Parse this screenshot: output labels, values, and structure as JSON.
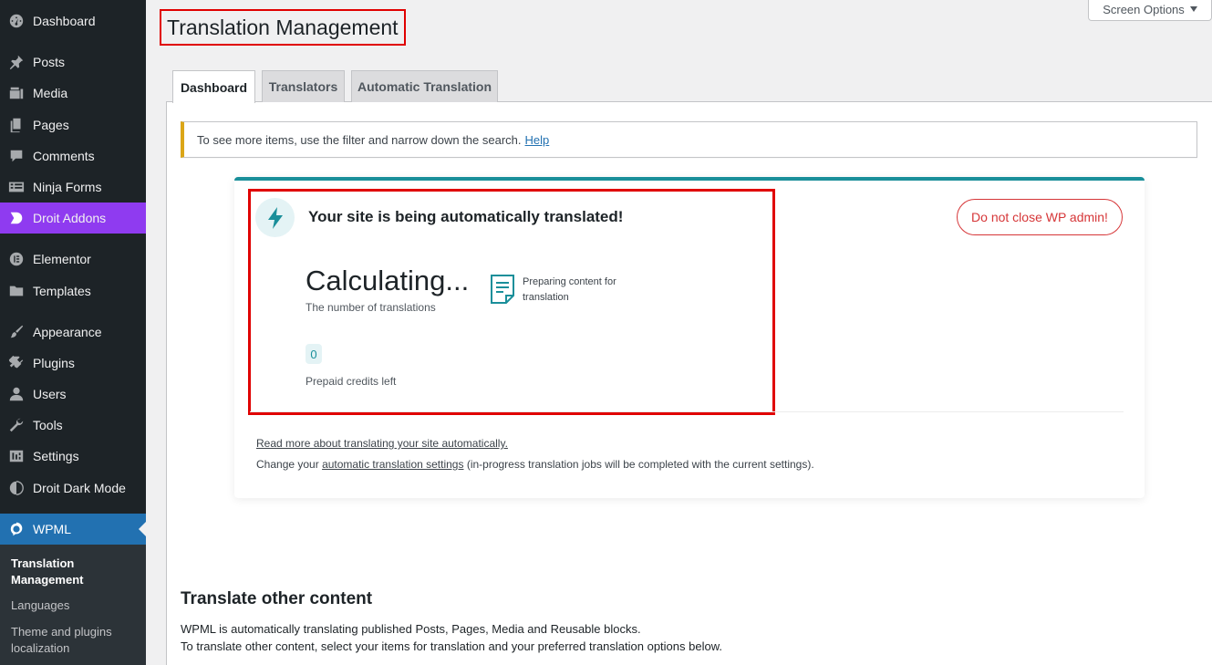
{
  "sidebar": {
    "items": [
      {
        "label": "Dashboard",
        "icon": "dashboard-icon"
      },
      {
        "label": "Posts",
        "icon": "pin-icon"
      },
      {
        "label": "Media",
        "icon": "media-icon"
      },
      {
        "label": "Pages",
        "icon": "pages-icon"
      },
      {
        "label": "Comments",
        "icon": "comments-icon"
      },
      {
        "label": "Ninja Forms",
        "icon": "forms-icon"
      },
      {
        "label": "Droit Addons",
        "icon": "droit-icon"
      },
      {
        "label": "Elementor",
        "icon": "elementor-icon"
      },
      {
        "label": "Templates",
        "icon": "folder-icon"
      },
      {
        "label": "Appearance",
        "icon": "brush-icon"
      },
      {
        "label": "Plugins",
        "icon": "plugin-icon"
      },
      {
        "label": "Users",
        "icon": "user-icon"
      },
      {
        "label": "Tools",
        "icon": "wrench-icon"
      },
      {
        "label": "Settings",
        "icon": "settings-icon"
      },
      {
        "label": "Droit Dark Mode",
        "icon": "moon-icon"
      },
      {
        "label": "WPML",
        "icon": "wpml-icon"
      }
    ],
    "submenu": [
      {
        "label": "Translation Management"
      },
      {
        "label": "Languages"
      },
      {
        "label": "Theme and plugins localization"
      }
    ]
  },
  "header": {
    "title": "Translation Management",
    "screen_options": "Screen Options"
  },
  "tabs": [
    {
      "label": "Dashboard"
    },
    {
      "label": "Translators"
    },
    {
      "label": "Automatic Translation"
    }
  ],
  "notice": {
    "text": "To see more items, use the filter and narrow down the search.",
    "link": "Help"
  },
  "card": {
    "heading": "Your site is being automatically translated!",
    "do_not_close": "Do not close WP admin!",
    "calculating": "Calculating...",
    "calc_label": "The number of translations",
    "preparing": "Preparing content for translation",
    "credits_value": "0",
    "credits_label": "Prepaid credits left",
    "read_more": "Read more about translating your site automatically.",
    "change_prefix": "Change your",
    "change_link": "automatic translation settings",
    "change_suffix": "(in-progress translation jobs will be completed with the current settings)."
  },
  "other": {
    "title": "Translate other content",
    "desc1": "WPML is automatically translating published Posts, Pages, Media and Reusable blocks.",
    "desc2": "To translate other content, select your items for translation and your preferred translation options below."
  },
  "colors": {
    "accent": "#2271b1",
    "droit": "#8f3bf0",
    "teal": "#1a8f9a",
    "warning": "#d63638",
    "notice_border": "#dba617"
  }
}
